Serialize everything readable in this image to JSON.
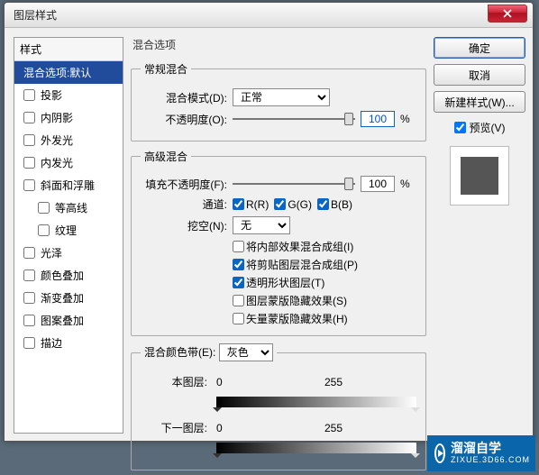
{
  "window": {
    "title": "图层样式"
  },
  "styles": {
    "header": "样式",
    "items": [
      {
        "label": "混合选项:默认",
        "checked": null,
        "selected": true
      },
      {
        "label": "投影",
        "checked": false
      },
      {
        "label": "内阴影",
        "checked": false
      },
      {
        "label": "外发光",
        "checked": false
      },
      {
        "label": "内发光",
        "checked": false
      },
      {
        "label": "斜面和浮雕",
        "checked": false
      },
      {
        "label": "等高线",
        "checked": false,
        "indent": true
      },
      {
        "label": "纹理",
        "checked": false,
        "indent": true
      },
      {
        "label": "光泽",
        "checked": false
      },
      {
        "label": "颜色叠加",
        "checked": false
      },
      {
        "label": "渐变叠加",
        "checked": false
      },
      {
        "label": "图案叠加",
        "checked": false
      },
      {
        "label": "描边",
        "checked": false
      }
    ]
  },
  "mid": {
    "panel_title": "混合选项",
    "general": {
      "legend": "常规混合",
      "blend_mode_label": "混合模式(D):",
      "blend_mode_value": "正常",
      "opacity_label": "不透明度(O):",
      "opacity_value": "100",
      "pct": "%"
    },
    "advanced": {
      "legend": "高级混合",
      "fill_label": "填充不透明度(F):",
      "fill_value": "100",
      "pct": "%",
      "channels_label": "通道:",
      "ch_r": "R(R)",
      "ch_g": "G(G)",
      "ch_b": "B(B)",
      "knockout_label": "挖空(N):",
      "knockout_value": "无",
      "opts": [
        {
          "label": "将内部效果混合成组(I)",
          "checked": false
        },
        {
          "label": "将剪贴图层混合成组(P)",
          "checked": true
        },
        {
          "label": "透明形状图层(T)",
          "checked": true
        },
        {
          "label": "图层蒙版隐藏效果(S)",
          "checked": false
        },
        {
          "label": "矢量蒙版隐藏效果(H)",
          "checked": false
        }
      ]
    },
    "blendif": {
      "legend": "混合颜色带(E):",
      "value": "灰色",
      "this_label": "本图层:",
      "this_lo": "0",
      "this_hi": "255",
      "under_label": "下一图层:",
      "under_lo": "0",
      "under_hi": "255"
    }
  },
  "right": {
    "ok": "确定",
    "cancel": "取消",
    "newstyle": "新建样式(W)...",
    "preview": "预览(V)"
  },
  "watermark": {
    "brand": "溜溜自学",
    "url": "ZIXUE.3D66.COM"
  }
}
